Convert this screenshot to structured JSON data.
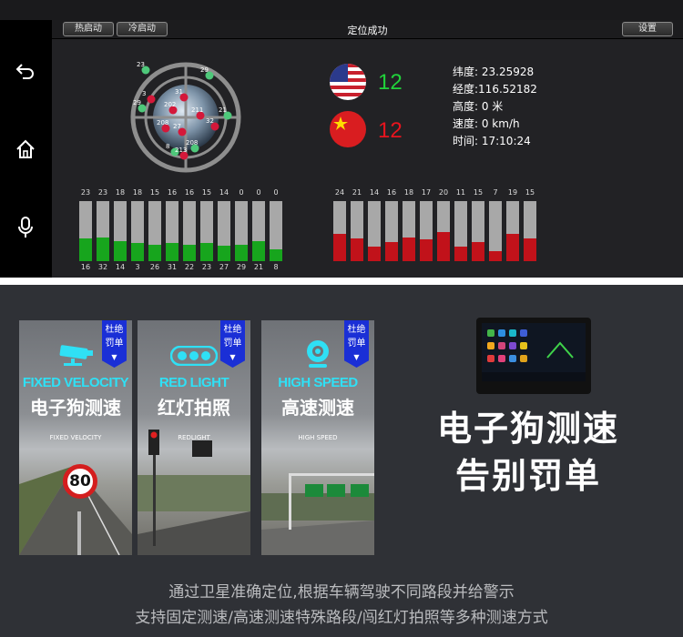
{
  "gps": {
    "buttons": {
      "hot_start": "热启动",
      "cold_start": "冷启动",
      "settings": "设置"
    },
    "title": "定位成功",
    "usa_count": "12",
    "china_count": "12",
    "info": {
      "latitude": "纬度: 23.25928",
      "longitude": "经度:116.52182",
      "altitude": "高度:     0 米",
      "speed": "速度:   0 km/h",
      "time": "时间:  17:10:24"
    },
    "sat_labels": [
      "23",
      "29",
      "3",
      "29",
      "202",
      "31",
      "208",
      "21",
      "211",
      "32",
      "27",
      "8",
      "213",
      "208"
    ],
    "green_bars": {
      "values": [
        "23",
        "23",
        "18",
        "18",
        "15",
        "16",
        "16",
        "15",
        "14",
        "0",
        "0",
        "0"
      ],
      "ids": [
        "16",
        "32",
        "14",
        "3",
        "26",
        "31",
        "22",
        "23",
        "27",
        "29",
        "21",
        "8"
      ],
      "levels": [
        0.38,
        0.4,
        0.34,
        0.3,
        0.27,
        0.3,
        0.28,
        0.3,
        0.26,
        0.28,
        0.34,
        0.2
      ]
    },
    "red_bars": {
      "values": [
        "24",
        "21",
        "14",
        "16",
        "18",
        "17",
        "20",
        "11",
        "15",
        "7",
        "19",
        "15"
      ],
      "levels": [
        0.46,
        0.38,
        0.25,
        0.32,
        0.4,
        0.36,
        0.48,
        0.25,
        0.32,
        0.16,
        0.46,
        0.38
      ]
    },
    "colors": {
      "green": "#17a51d",
      "red": "#c1121a",
      "count_green": "#20d23a",
      "count_red": "#e8141e"
    }
  },
  "panels": [
    {
      "badge1": "杜绝",
      "badge2": "罚单",
      "en": "FIXED VELOCITY",
      "zh": "电子狗测速",
      "sub": "FIXED VELOCITY",
      "sign": "80",
      "icon": "camera-icon"
    },
    {
      "badge1": "杜绝",
      "badge2": "罚单",
      "en": "RED LIGHT",
      "zh": "红灯拍照",
      "sub": "REDLIGHT",
      "icon": "traffic-light-icon"
    },
    {
      "badge1": "杜绝",
      "badge2": "罚单",
      "en": "HIGH SPEED",
      "zh": "高速测速",
      "sub": "HIGH SPEED",
      "icon": "webcam-icon"
    }
  ],
  "slogan": {
    "line1": "电子狗测速",
    "line2": "告别罚单"
  },
  "footer": {
    "line1": "通过卫星准确定位,根据车辆驾驶不同路段并给警示",
    "line2": "支持固定测速/高速测速特殊路段/闯红灯拍照等多种测速方式"
  }
}
